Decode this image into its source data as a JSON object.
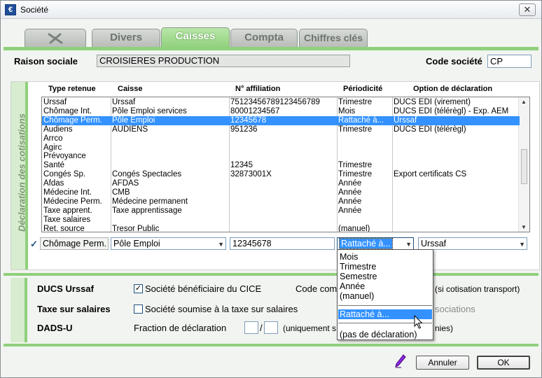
{
  "window": {
    "title": "Société",
    "close_label": "✕"
  },
  "tabs": [
    {
      "label": "",
      "icon": "dragonfly-icon"
    },
    {
      "label": "Divers"
    },
    {
      "label": "Caisses",
      "active": true
    },
    {
      "label": "Compta"
    },
    {
      "label": "Chiffres clés"
    }
  ],
  "header": {
    "raison_label": "Raison sociale",
    "raison_value": "CROISIERES PRODUCTION",
    "code_label": "Code société",
    "code_value": "CP"
  },
  "cotisations": {
    "section_label": "Déclaration des cotisations",
    "columns": [
      "Type retenue",
      "Caisse",
      "N° affiliation",
      "Périodicité",
      "Option de déclaration"
    ],
    "rows": [
      [
        "Urssaf",
        "Urssaf",
        "75123456789123456789",
        "Trimestre",
        "DUCS EDI (virement)"
      ],
      [
        "Chômage Int.",
        "Pôle Emploi services",
        "80001234567",
        "Mois",
        "DUCS EDI (télérègl) - Exp. AEM"
      ],
      [
        "Chômage Perm.",
        "Pôle Emploi",
        "12345678",
        "Rattaché à...",
        "Urssaf"
      ],
      [
        "Audiens",
        "AUDIENS",
        "951236",
        "Trimestre",
        "DUCS EDI (télérègl)"
      ],
      [
        "Arrco",
        "",
        "",
        "",
        ""
      ],
      [
        "Agirc",
        "",
        "",
        "",
        ""
      ],
      [
        "Prévoyance",
        "",
        "",
        "",
        ""
      ],
      [
        "Santé",
        "",
        "12345",
        "Trimestre",
        ""
      ],
      [
        "Congés Sp.",
        "Congés Spectacles",
        "32873001X",
        "Trimestre",
        "Export certificats CS"
      ],
      [
        "Afdas",
        "AFDAS",
        "",
        "Année",
        ""
      ],
      [
        "Médecine Int.",
        "CMB",
        "",
        "Année",
        ""
      ],
      [
        "Médecine Perm.",
        "Médecine permanent",
        "",
        "Année",
        ""
      ],
      [
        "Taxe apprent.",
        "Taxe apprentissage",
        "",
        "Année",
        ""
      ],
      [
        "Taxe salaires",
        "",
        "",
        "",
        ""
      ],
      [
        "Ret. source",
        "Tresor Public",
        "",
        "(manuel)",
        ""
      ]
    ],
    "edit": {
      "check_mark": "✓",
      "type": "Chômage Perm.",
      "caisse": "Pôle Emploi",
      "affiliation": "12345678",
      "periodicite": "Rattaché à...",
      "option": "Urssaf"
    }
  },
  "periodicite_dropdown": {
    "options_top": [
      "Mois",
      "Trimestre",
      "Semestre",
      "Année",
      "(manuel)"
    ],
    "hover_option": "Rattaché à...",
    "option_bottom": "(pas de déclaration)"
  },
  "settings": {
    "ducs_label": "DUCS Urssaf",
    "cice_label": "Société bénéficiaire du CICE",
    "cice_checked": true,
    "code_com_label": "Code com",
    "transport_note": "(si cotisation transport)",
    "taxe_label": "Taxe sur salaires",
    "taxe_check_label": "Société soumise à la taxe sur salaires",
    "taxe_checked": false,
    "associations_fragment": "sociations",
    "dads_label": "DADS-U",
    "fraction_label": "Fraction de déclaration",
    "frac_sep": "/",
    "uniquement_fragment": "(uniquement s",
    "mes_fragment": "nies)"
  },
  "footer": {
    "cancel_label": "Annuler",
    "ok_label": "OK"
  },
  "colors": {
    "accent_green": "#8fd07c",
    "selection_blue": "#3392ff"
  }
}
